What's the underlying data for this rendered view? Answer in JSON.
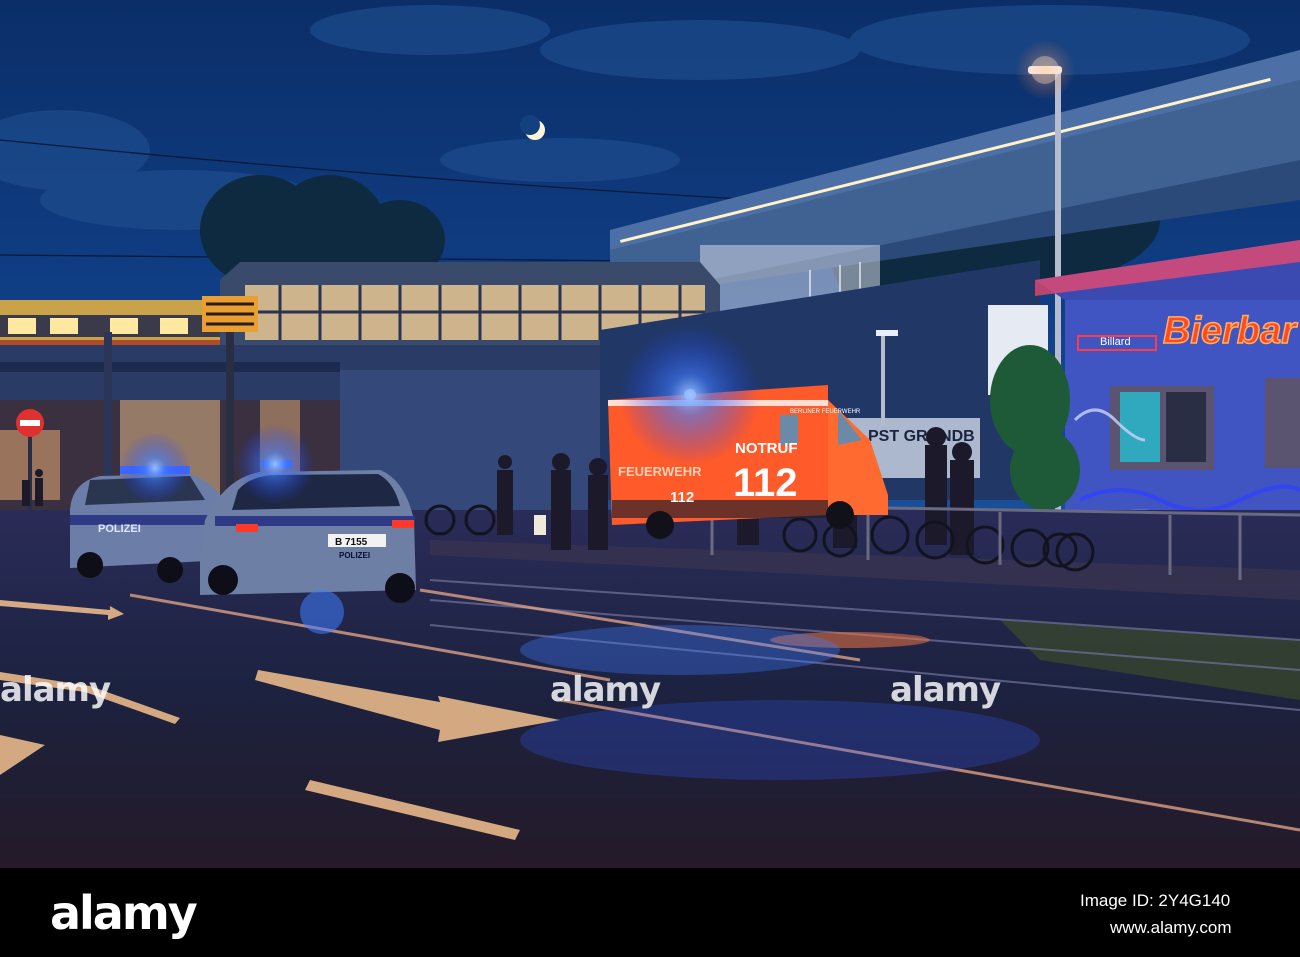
{
  "photo": {
    "watermark": "alamy",
    "signs": {
      "bar_neon": "Bierbar",
      "bar_sub": "Billard",
      "ambulance_emergency": "NOTRUF",
      "ambulance_number": "112",
      "ambulance_side": "FEUERWEHR",
      "ambulance_small_number": "112",
      "ambulance_roof": "BERLINER FEUERWEHR",
      "police_door": "POLIZEI",
      "police_plate": "B 7155",
      "police_rear": "POLIZEI",
      "wall_sign": "PST GRONDB"
    },
    "colors": {
      "sky": "#0f3a7a",
      "street": "#1c2340",
      "neon_red": "#ff3a1e",
      "blue_light": "#3f7bff",
      "ambulance": "#ff5a2a"
    }
  },
  "footer": {
    "logo": "alamy",
    "image_id": "Image ID: 2Y4G140",
    "url": "www.alamy.com"
  }
}
